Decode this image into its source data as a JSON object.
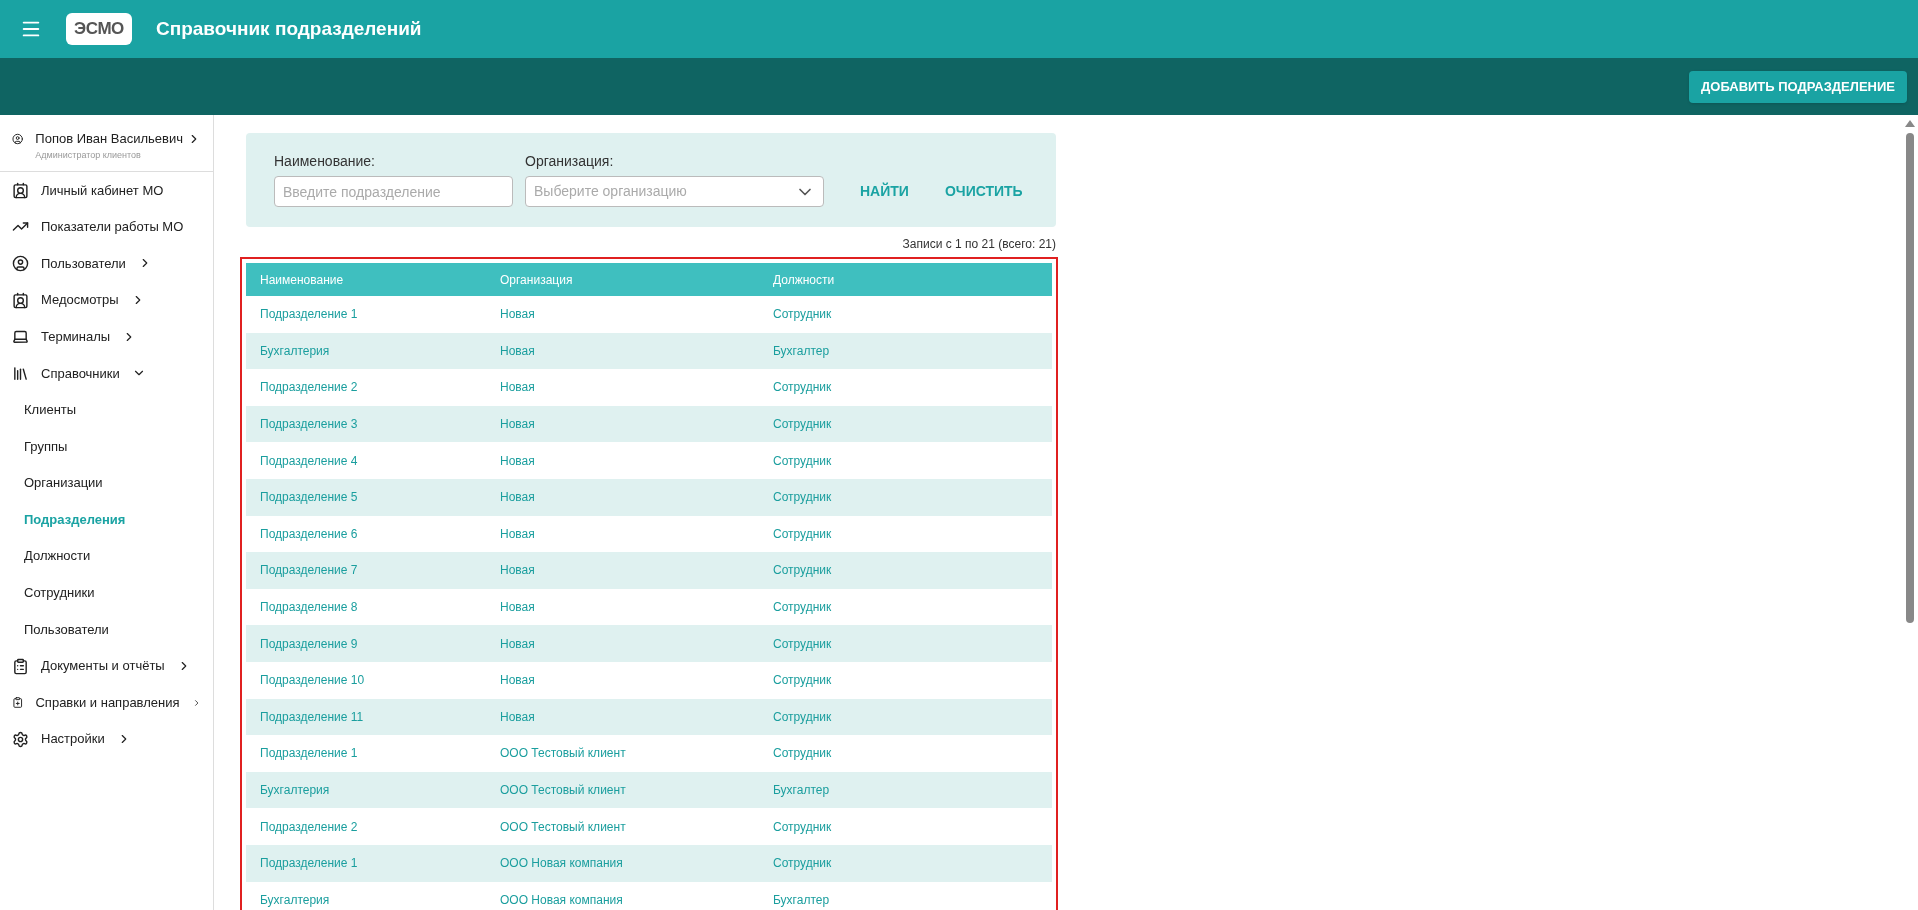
{
  "header": {
    "logo": "ЭСМО",
    "title": "Справочник подразделений"
  },
  "toolbar": {
    "add_button": "ДОБАВИТЬ ПОДРАЗДЕЛЕНИЕ"
  },
  "user": {
    "name": "Попов Иван Васильевич",
    "role": "Администратор клиентов"
  },
  "sidebar": {
    "items": [
      {
        "kind": "item",
        "label": "Личный кабинет МО"
      },
      {
        "kind": "item",
        "label": "Показатели работы МО"
      },
      {
        "kind": "group",
        "label": "Пользователи",
        "expanded": false
      },
      {
        "kind": "group",
        "label": "Медосмотры",
        "expanded": false
      },
      {
        "kind": "group",
        "label": "Терминалы",
        "expanded": false
      },
      {
        "kind": "group",
        "label": "Справочники",
        "expanded": true,
        "children": [
          {
            "label": "Клиенты",
            "selected": false
          },
          {
            "label": "Группы",
            "selected": false
          },
          {
            "label": "Организации",
            "selected": false
          },
          {
            "label": "Подразделения",
            "selected": true
          },
          {
            "label": "Должности",
            "selected": false
          },
          {
            "label": "Сотрудники",
            "selected": false
          },
          {
            "label": "Пользователи",
            "selected": false
          }
        ]
      },
      {
        "kind": "group",
        "label": "Документы и отчёты",
        "expanded": false
      },
      {
        "kind": "group",
        "label": "Справки и направления",
        "expanded": false
      },
      {
        "kind": "group",
        "label": "Настройки",
        "expanded": false
      }
    ]
  },
  "filter": {
    "name_label": "Наименование:",
    "name_placeholder": "Введите подразделение",
    "org_label": "Организация:",
    "org_placeholder": "Выберите организацию",
    "find_button": "НАЙТИ",
    "clear_button": "ОЧИСТИТЬ"
  },
  "records_info": "Записи с 1 по 21 (всего: 21)",
  "table": {
    "columns": [
      "Наименование",
      "Организация",
      "Должности"
    ],
    "rows": [
      [
        "Подразделение 1",
        "Новая",
        "Сотрудник"
      ],
      [
        "Бухгалтерия",
        "Новая",
        "Бухгалтер"
      ],
      [
        "Подразделение 2",
        "Новая",
        "Сотрудник"
      ],
      [
        "Подразделение 3",
        "Новая",
        "Сотрудник"
      ],
      [
        "Подразделение 4",
        "Новая",
        "Сотрудник"
      ],
      [
        "Подразделение 5",
        "Новая",
        "Сотрудник"
      ],
      [
        "Подразделение 6",
        "Новая",
        "Сотрудник"
      ],
      [
        "Подразделение 7",
        "Новая",
        "Сотрудник"
      ],
      [
        "Подразделение 8",
        "Новая",
        "Сотрудник"
      ],
      [
        "Подразделение 9",
        "Новая",
        "Сотрудник"
      ],
      [
        "Подразделение 10",
        "Новая",
        "Сотрудник"
      ],
      [
        "Подразделение 11",
        "Новая",
        "Сотрудник"
      ],
      [
        "Подразделение 1",
        "ООО Тестовый клиент",
        "Сотрудник"
      ],
      [
        "Бухгалтерия",
        "ООО Тестовый клиент",
        "Бухгалтер"
      ],
      [
        "Подразделение 2",
        "ООО Тестовый клиент",
        "Сотрудник"
      ],
      [
        "Подразделение 1",
        "ООО Новая компания",
        "Сотрудник"
      ],
      [
        "Бухгалтерия",
        "ООО Новая компания",
        "Бухгалтер"
      ]
    ]
  }
}
